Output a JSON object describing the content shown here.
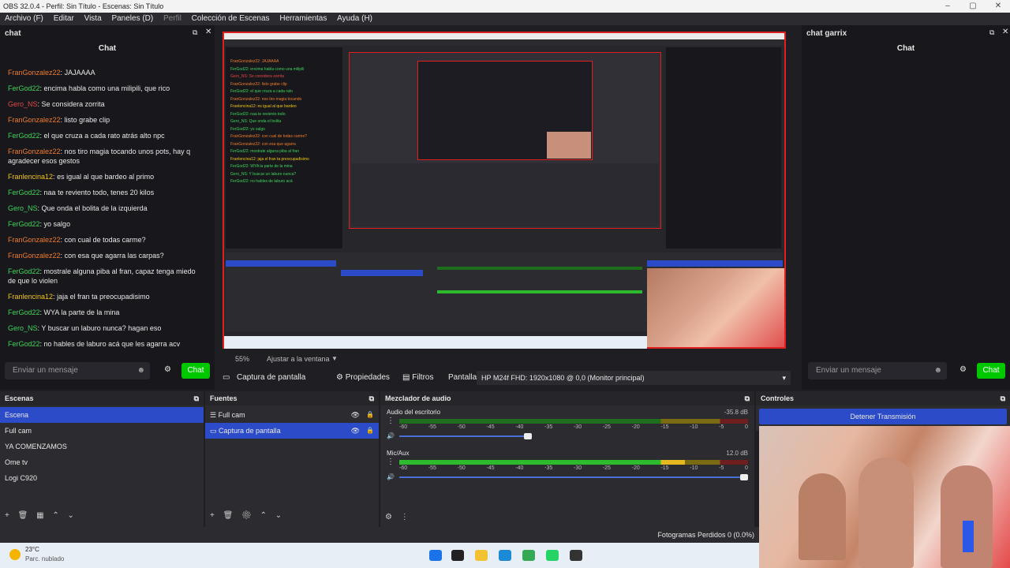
{
  "window": {
    "title": "OBS 32.0.4 - Perfil: Sin Título - Escenas: Sin Título"
  },
  "menu": [
    "Archivo (F)",
    "Editar",
    "Vista",
    "Paneles (D)",
    "Perfil",
    "Colección de Escenas",
    "Herramientas",
    "Ayuda (H)"
  ],
  "left_chat": {
    "dock_title": "chat",
    "header": "Chat",
    "messages": [
      {
        "user": "FranGonzalez22",
        "color": "orange",
        "text": " JAJAAAA"
      },
      {
        "user": "FerGod22",
        "color": "green",
        "text": " encima habla como una milipili, que rico"
      },
      {
        "user": "Gero_NS",
        "color": "red",
        "text": " Se considera zorrita"
      },
      {
        "user": "FranGonzalez22",
        "color": "orange",
        "text": " listo grabe clip"
      },
      {
        "user": "FerGod22",
        "color": "green",
        "text": " el que cruza a cada rato atrás alto npc"
      },
      {
        "user": "FranGonzalez22",
        "color": "orange",
        "text": " nos tiro magia tocando unos pots, hay q agradecer esos gestos"
      },
      {
        "user": "Franlencina12",
        "color": "yellow",
        "text": " es igual al que bardeo al primo"
      },
      {
        "user": "FerGod22",
        "color": "green",
        "text": " naa te reviento todo, tenes 20 kilos"
      },
      {
        "user": "Gero_NS",
        "color": "green",
        "text": " Que onda el bolita de la izquierda"
      },
      {
        "user": "FerGod22",
        "color": "green",
        "text": " yo salgo"
      },
      {
        "user": "FranGonzalez22",
        "color": "orange",
        "text": " con cual de todas carme?"
      },
      {
        "user": "FranGonzalez22",
        "color": "orange",
        "text": " con esa que agarra las carpas?"
      },
      {
        "user": "FerGod22",
        "color": "green",
        "text": " mostrale alguna piba al fran, capaz tenga miedo de que lo violen"
      },
      {
        "user": "Franlencina12",
        "color": "yellow",
        "text": " jaja el fran ta preocupadisimo"
      },
      {
        "user": "FerGod22",
        "color": "green",
        "text": " WYA la parte de la mina"
      },
      {
        "user": "Gero_NS",
        "color": "green",
        "text": " Y buscar un laburo nunca? hagan eso"
      },
      {
        "user": "FerGod22",
        "color": "green",
        "text": " no hables de laburo acá que les agarra acv"
      }
    ],
    "input_placeholder": "Enviar un mensaje",
    "send_label": "Chat"
  },
  "right_chat": {
    "dock_title": "chat garrix",
    "header": "Chat",
    "input_placeholder": "Enviar un mensaje",
    "send_label": "Chat"
  },
  "preview": {
    "zoom": "55%",
    "fit_label": "Ajustar a la ventana"
  },
  "source_toolbar": {
    "source_name": "Captura de pantalla",
    "properties": "Propiedades",
    "filters": "Filtros",
    "screen_label": "Pantalla",
    "screen_value": "HP M24f FHD: 1920x1080 @ 0,0 (Monitor principal)"
  },
  "scenes": {
    "title": "Escenas",
    "items": [
      "Escena",
      "Full cam",
      "YA COMENZAMOS",
      "Ome tv",
      "Logi C920"
    ],
    "selected": 0
  },
  "sources": {
    "title": "Fuentes",
    "items": [
      "Full cam",
      "Captura de pantalla"
    ],
    "selected": 1
  },
  "mixer": {
    "title": "Mezclador de audio",
    "channels": [
      {
        "name": "Audio del escritorio",
        "db": "-35.8 dB",
        "level": 0.0,
        "volume": 0.38
      },
      {
        "name": "Mic/Aux",
        "db": "12.0 dB",
        "level": 0.82,
        "volume": 1.0
      }
    ],
    "ticks": [
      "-60",
      "-55",
      "-50",
      "-45",
      "-40",
      "-35",
      "-30",
      "-25",
      "-20",
      "-15",
      "-10",
      "-5",
      "0"
    ]
  },
  "controls": {
    "title": "Controles",
    "stop_stream": "Detener Transmisión"
  },
  "status": {
    "dropped_frames": "Fotogramas Perdidos 0 (0.0%)"
  },
  "weather": {
    "temp": "23°C",
    "desc": "Parc. nublado"
  },
  "colors": {
    "accent": "#2c4bc9",
    "chat_button": "#00c800",
    "preview_border": "#e02020"
  }
}
